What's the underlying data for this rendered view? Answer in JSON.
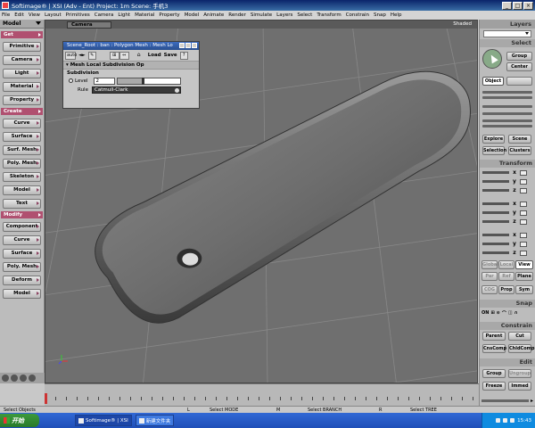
{
  "window": {
    "title": "Softimage® | XSI (Adv - Ent) Project: 1m        Scene: 手机3",
    "minimize": "_",
    "maximize": "□",
    "close": "×"
  },
  "menubar": [
    "File",
    "Edit",
    "View",
    "Layout",
    "Primitives",
    "Camera",
    "Light",
    "Material",
    "Property",
    "Model",
    "Animate",
    "Render",
    "Simulate",
    "Layers",
    "Select",
    "Transform",
    "Constrain",
    "Snap",
    "Help"
  ],
  "left_panel": {
    "header": "Model",
    "sections": [
      {
        "title": "Get",
        "buttons": [
          "Primitive",
          "Camera",
          "Light",
          "Material",
          "Property"
        ]
      },
      {
        "title": "Create",
        "buttons": [
          "Curve",
          "Surface",
          "Surf. Mesh",
          "Poly. Mesh",
          "Skeleton",
          "Model",
          "Text"
        ]
      },
      {
        "title": "Modify",
        "buttons": [
          "Component",
          "Curve",
          "Surface",
          "Poly. Mesh",
          "Deform",
          "Model"
        ]
      }
    ]
  },
  "viewport": {
    "camera_label": "Camera",
    "shading_label": "Shaded"
  },
  "dialog": {
    "title": "Scene_Root : ban : Polygon Mesh : Mesh Lo",
    "auto": "auto",
    "load": "Load",
    "save": "Save",
    "help": "?",
    "section": "Mesh Local Subdivision Op",
    "group": "Subdivision",
    "level_label": "Level",
    "level_value": "2",
    "level_fraction": 0.4,
    "rule_label": "Rule",
    "rule_value": "Catmull-Clark"
  },
  "right_panel": {
    "layers_header": "Layers",
    "layers_combo": "",
    "select_header": "Select",
    "group_btn": "Group",
    "center_btn": "Center",
    "object_btn": "Object",
    "explore_btn": "Explore",
    "scene_btn": "Scene",
    "selection_btn": "Selection",
    "clusters_btn": "Clusters",
    "transform_header": "Transform",
    "axes": [
      "x",
      "y",
      "z"
    ],
    "global_btn": "Global",
    "local_btn": "Local",
    "view_btn": "View",
    "par_btn": "Par",
    "ref_btn": "Ref",
    "plane_btn": "Plane",
    "cog_btn": "COG",
    "prop_btn": "Prop",
    "sym_btn": "Sym",
    "snap_header": "Snap",
    "snap_on": "ON",
    "constrain_header": "Constrain",
    "parent_btn": "Parent",
    "cut_btn": "Cut",
    "cnscomp_btn": "CnsComp",
    "chldcomp_btn": "ChldComp",
    "edit_header": "Edit",
    "group2_btn": "Group",
    "ungroup_btn": "Ungroup",
    "freeze_btn": "Freeze",
    "immed_btn": "Immed"
  },
  "statusbar": {
    "left": "Select Objects",
    "mid1": "Select MODE",
    "mid2": "Select BRANCH",
    "mid3": "Select TREE",
    "mark1": "L",
    "mark2": "M",
    "mark3": "R"
  },
  "taskbar": {
    "start": "开始",
    "tasks": [
      "Softimage® | XSI",
      "新建文件夹"
    ],
    "clock": "15:43"
  }
}
